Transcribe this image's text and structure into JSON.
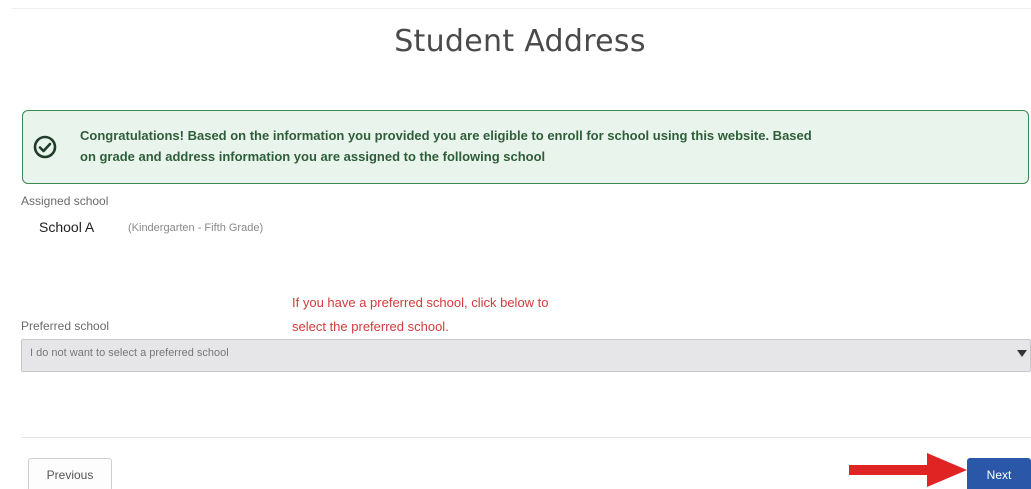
{
  "page": {
    "title": "Student Address"
  },
  "alert": {
    "icon": "check-circle-icon",
    "line1": "Congratulations! Based on the information you provided you are eligible to enroll for school using this website. Based",
    "line2": "on grade and address information you are assigned to the following school"
  },
  "assigned": {
    "label": "Assigned school",
    "school_name": "School A",
    "grade_range": "(Kindergarten - Fifth Grade)"
  },
  "note": {
    "line1": "If you have a preferred school, click below to",
    "line2": "select the preferred school."
  },
  "preferred": {
    "label": "Preferred school",
    "selected_value": "I do not want to select a preferred school"
  },
  "buttons": {
    "previous": "Previous",
    "next": "Next"
  },
  "colors": {
    "alert_bg": "#e9f5ec",
    "alert_border": "#3a8a4f",
    "note_text": "#d23b3b",
    "next_button": "#2a57a8",
    "arrow": "#e02424"
  }
}
